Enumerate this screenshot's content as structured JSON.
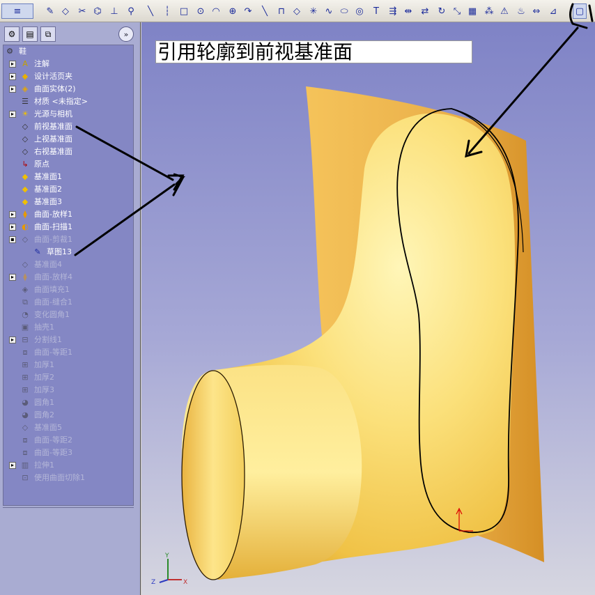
{
  "toolbar": {
    "icons": [
      "menu-dropdown-icon",
      "sketch-icon",
      "smart-dimension-icon",
      "trim-icon",
      "convert-entities-icon",
      "relations-icon",
      "construction-geometry-icon",
      "line-icon",
      "centerline-icon",
      "rectangle-icon",
      "circle-icon",
      "arc-icon",
      "circle-alt-icon",
      "tangent-arc-icon",
      "line-alt-icon",
      "slot-icon",
      "polygon-icon",
      "point-icon",
      "spline-icon",
      "ellipse-icon",
      "partial-ellipse-icon",
      "text-icon",
      "offset-icon",
      "mirror-icon",
      "move-icon",
      "rotate-icon",
      "scale-icon",
      "linear-pattern-icon",
      "circular-pattern-icon",
      "fix-icon",
      "relation-display-icon",
      "dimension-icon",
      "block-icon",
      "view-orientation-icon"
    ]
  },
  "panel": {
    "tabs": [
      "feature-manager-icon",
      "property-manager-icon",
      "configuration-manager-icon"
    ],
    "expand_label": "»"
  },
  "tree": {
    "items": [
      {
        "label": "鞋",
        "icon": "part-icon",
        "toggle": "",
        "indent": 0,
        "dim": false
      },
      {
        "label": "注解",
        "icon": "annotation-icon",
        "toggle": "+",
        "indent": 1,
        "dim": false
      },
      {
        "label": "设计活页夹",
        "icon": "design-binder-icon",
        "toggle": "+",
        "indent": 1,
        "dim": false
      },
      {
        "label": "曲面实体(2)",
        "icon": "surface-bodies-icon",
        "toggle": "+",
        "indent": 1,
        "dim": false
      },
      {
        "label": "材质 <未指定>",
        "icon": "material-icon",
        "toggle": "",
        "indent": 1,
        "dim": false
      },
      {
        "label": "光源与相机",
        "icon": "lights-camera-icon",
        "toggle": "+",
        "indent": 1,
        "dim": false
      },
      {
        "label": "前视基准面",
        "icon": "plane-icon",
        "toggle": "",
        "indent": 1,
        "dim": false
      },
      {
        "label": "上视基准面",
        "icon": "plane-icon",
        "toggle": "",
        "indent": 1,
        "dim": false
      },
      {
        "label": "右视基准面",
        "icon": "plane-icon",
        "toggle": "",
        "indent": 1,
        "dim": false
      },
      {
        "label": "原点",
        "icon": "origin-icon",
        "toggle": "",
        "indent": 1,
        "dim": false
      },
      {
        "label": "基准面1",
        "icon": "plane-yellow-icon",
        "toggle": "",
        "indent": 1,
        "dim": false
      },
      {
        "label": "基准面2",
        "icon": "plane-yellow-icon",
        "toggle": "",
        "indent": 1,
        "dim": false
      },
      {
        "label": "基准面3",
        "icon": "plane-yellow-icon",
        "toggle": "",
        "indent": 1,
        "dim": false
      },
      {
        "label": "曲面-放样1",
        "icon": "loft-surface-icon",
        "toggle": "+",
        "indent": 1,
        "dim": false
      },
      {
        "label": "曲面-扫描1",
        "icon": "sweep-surface-icon",
        "toggle": "+",
        "indent": 1,
        "dim": false
      },
      {
        "label": "曲面-剪裁1",
        "icon": "trim-surface-icon",
        "toggle": "-",
        "indent": 1,
        "dim": true
      },
      {
        "label": "草图13",
        "icon": "sketch-icon",
        "toggle": "",
        "indent": 2,
        "dim": false
      },
      {
        "label": "基准面4",
        "icon": "plane-icon",
        "toggle": "",
        "indent": 1,
        "dim": true
      },
      {
        "label": "曲面-放样4",
        "icon": "loft-surface-icon",
        "toggle": "+",
        "indent": 1,
        "dim": true
      },
      {
        "label": "曲面填充1",
        "icon": "fill-surface-icon",
        "toggle": "",
        "indent": 1,
        "dim": true
      },
      {
        "label": "曲面-缝合1",
        "icon": "knit-surface-icon",
        "toggle": "",
        "indent": 1,
        "dim": true
      },
      {
        "label": "变化圆角1",
        "icon": "variable-fillet-icon",
        "toggle": "",
        "indent": 1,
        "dim": true
      },
      {
        "label": "抽壳1",
        "icon": "shell-icon",
        "toggle": "",
        "indent": 1,
        "dim": true
      },
      {
        "label": "分割线1",
        "icon": "split-line-icon",
        "toggle": "+",
        "indent": 1,
        "dim": true
      },
      {
        "label": "曲面-等距1",
        "icon": "offset-surface-icon",
        "toggle": "",
        "indent": 1,
        "dim": true
      },
      {
        "label": "加厚1",
        "icon": "thicken-icon",
        "toggle": "",
        "indent": 1,
        "dim": true
      },
      {
        "label": "加厚2",
        "icon": "thicken-icon",
        "toggle": "",
        "indent": 1,
        "dim": true
      },
      {
        "label": "加厚3",
        "icon": "thicken-icon",
        "toggle": "",
        "indent": 1,
        "dim": true
      },
      {
        "label": "圆角1",
        "icon": "fillet-icon",
        "toggle": "",
        "indent": 1,
        "dim": true
      },
      {
        "label": "圆角2",
        "icon": "fillet-icon",
        "toggle": "",
        "indent": 1,
        "dim": true
      },
      {
        "label": "基准面5",
        "icon": "plane-icon",
        "toggle": "",
        "indent": 1,
        "dim": true
      },
      {
        "label": "曲面-等距2",
        "icon": "offset-surface-icon",
        "toggle": "",
        "indent": 1,
        "dim": true
      },
      {
        "label": "曲面-等距3",
        "icon": "offset-surface-icon",
        "toggle": "",
        "indent": 1,
        "dim": true
      },
      {
        "label": "拉伸1",
        "icon": "extrude-icon",
        "toggle": "+",
        "indent": 1,
        "dim": true
      },
      {
        "label": "使用曲面切除1",
        "icon": "surface-cut-icon",
        "toggle": "",
        "indent": 1,
        "dim": true
      }
    ]
  },
  "viewport": {
    "caption": "引用轮廓到前视基准面",
    "triad": {
      "x": "X",
      "y": "Y",
      "z": "Z"
    },
    "colors": {
      "surface": "#f4c24a",
      "surface_light": "#fff2a0",
      "sheet": "#e9a93a",
      "annotation": "#000000"
    }
  }
}
